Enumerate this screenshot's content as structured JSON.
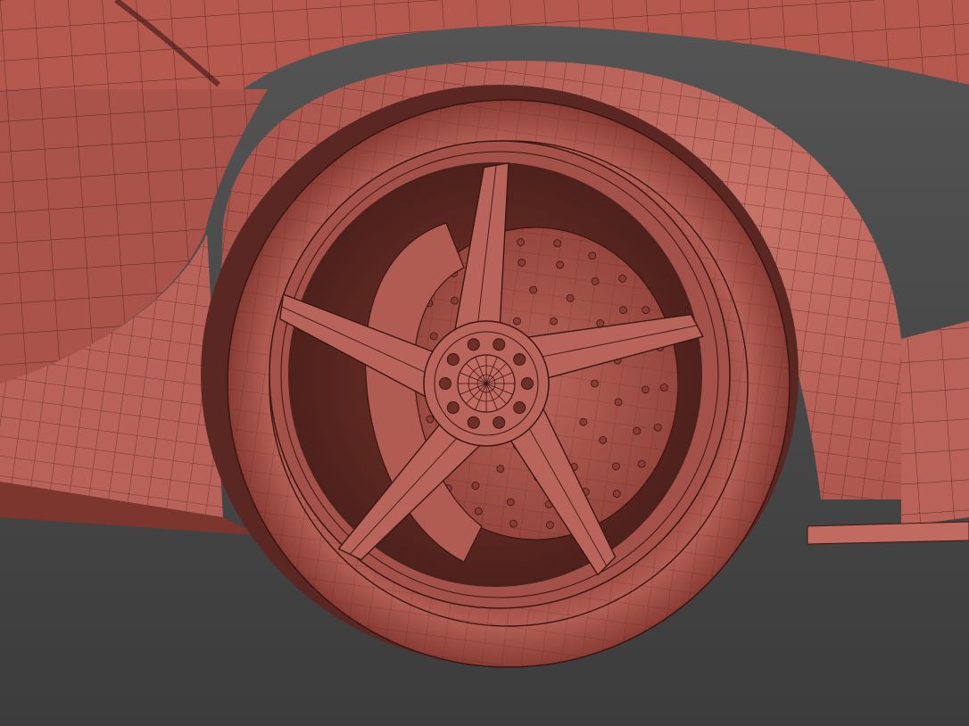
{
  "scene": {
    "subject": "car-rear-wheel-wireframe-render",
    "colors": {
      "background": "#4a4a4a",
      "background_bottom": "#3f3f3f",
      "body": "#b65a4f",
      "body_light": "#c46b5f",
      "body_dark": "#8e3f36",
      "shadow": "#5e2a24",
      "wire": "#3a1612"
    }
  }
}
